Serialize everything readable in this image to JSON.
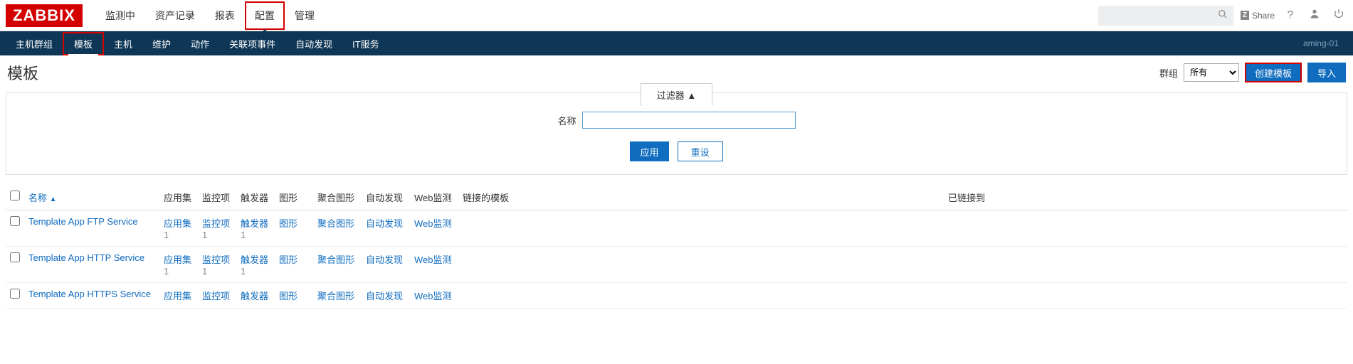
{
  "logo": "ZABBIX",
  "top_nav": {
    "items": [
      "监测中",
      "资产记录",
      "报表",
      "配置",
      "管理"
    ],
    "active_index": 3
  },
  "top_right": {
    "share_label": "Share",
    "help_label": "?",
    "user_icon": "user-icon",
    "power_icon": "power-icon"
  },
  "sub_nav": {
    "items": [
      "主机群组",
      "模板",
      "主机",
      "维护",
      "动作",
      "关联项事件",
      "自动发现",
      "IT服务"
    ],
    "active_index": 1,
    "right_text": "aming-01"
  },
  "page": {
    "title": "模板",
    "group_label": "群组",
    "group_value": "所有",
    "create_label": "创建模板",
    "import_label": "导入"
  },
  "filter": {
    "tab_label": "过滤器 ▲",
    "name_label": "名称",
    "name_value": "",
    "apply_label": "应用",
    "reset_label": "重设"
  },
  "table": {
    "headers": {
      "name": "名称",
      "sort_arrow": "▲",
      "app": "应用集",
      "item": "监控项",
      "trigger": "触发器",
      "graph": "图形",
      "screen": "聚合图形",
      "discovery": "自动发现",
      "web": "Web监测",
      "linked": "链接的模板",
      "linkedto": "已链接到"
    },
    "rows": [
      {
        "name": "Template App FTP Service",
        "app": {
          "label": "应用集",
          "count": "1"
        },
        "item": {
          "label": "监控项",
          "count": "1"
        },
        "trigger": {
          "label": "触发器",
          "count": "1"
        },
        "graph": {
          "label": "图形",
          "count": ""
        },
        "screen": {
          "label": "聚合图形",
          "count": ""
        },
        "discovery": {
          "label": "自动发现",
          "count": ""
        },
        "web": {
          "label": "Web监测",
          "count": ""
        }
      },
      {
        "name": "Template App HTTP Service",
        "app": {
          "label": "应用集",
          "count": "1"
        },
        "item": {
          "label": "监控项",
          "count": "1"
        },
        "trigger": {
          "label": "触发器",
          "count": "1"
        },
        "graph": {
          "label": "图形",
          "count": ""
        },
        "screen": {
          "label": "聚合图形",
          "count": ""
        },
        "discovery": {
          "label": "自动发现",
          "count": ""
        },
        "web": {
          "label": "Web监测",
          "count": ""
        }
      },
      {
        "name": "Template App HTTPS Service",
        "app": {
          "label": "应用集",
          "count": ""
        },
        "item": {
          "label": "监控项",
          "count": ""
        },
        "trigger": {
          "label": "触发器",
          "count": ""
        },
        "graph": {
          "label": "图形",
          "count": ""
        },
        "screen": {
          "label": "聚合图形",
          "count": ""
        },
        "discovery": {
          "label": "自动发现",
          "count": ""
        },
        "web": {
          "label": "Web监测",
          "count": ""
        }
      }
    ]
  }
}
